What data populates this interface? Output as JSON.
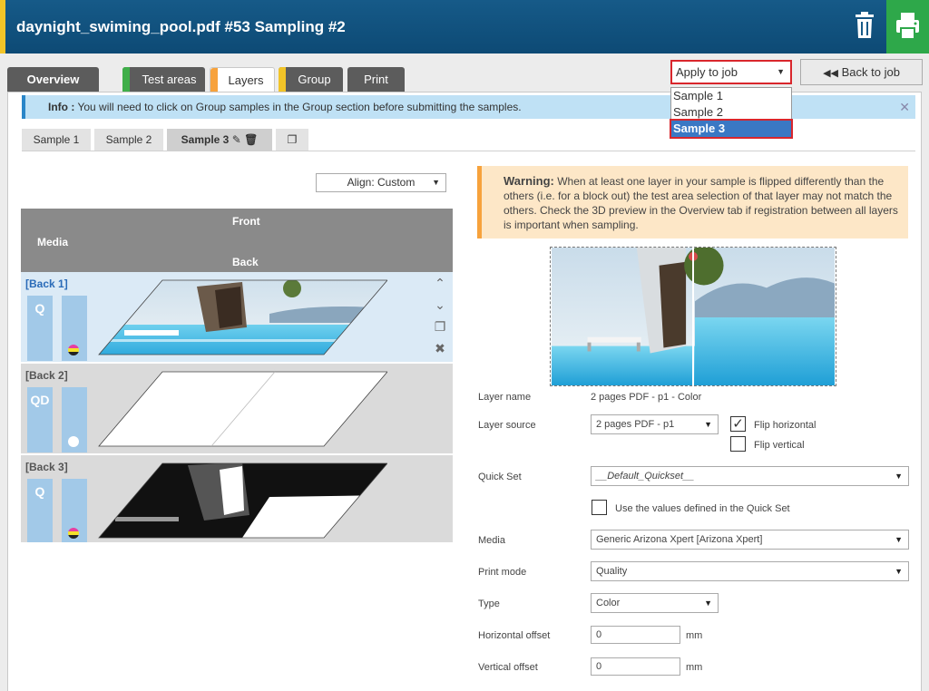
{
  "header": {
    "title": "daynight_swiming_pool.pdf #53 Sampling #2",
    "accent_color": "#f2c428",
    "bg_color": "#0d4a75",
    "print_color": "#2ea84a"
  },
  "tabs": [
    {
      "label": "Overview",
      "indicator": null
    },
    {
      "label": "Test areas",
      "indicator": "#3fae49"
    },
    {
      "label": "Layers",
      "indicator": "#f7a23c"
    },
    {
      "label": "Group",
      "indicator": "#f2c428"
    },
    {
      "label": "Print",
      "indicator": null
    }
  ],
  "apply": {
    "label": "Apply to job",
    "options": [
      "Sample 1",
      "Sample 2",
      "Sample 3"
    ],
    "selected": "Sample 3"
  },
  "back_button": {
    "label": "Back to job"
  },
  "info": {
    "prefix": "Info :",
    "text": "You will need to click on Group samples in the Group section before submitting the samples."
  },
  "sample_tabs": [
    "Sample 1",
    "Sample 2",
    "Sample 3"
  ],
  "align": {
    "label": "Align: Custom"
  },
  "layer_header": {
    "front": "Front",
    "media": "Media",
    "back": "Back"
  },
  "layers": [
    {
      "name": "[Back 1]",
      "mode": "Q",
      "swatch": "cmyk",
      "selected": true
    },
    {
      "name": "[Back 2]",
      "mode": "QD",
      "swatch": "white",
      "selected": false
    },
    {
      "name": "[Back 3]",
      "mode": "Q",
      "swatch": "cmyk",
      "selected": false
    }
  ],
  "warning": {
    "title": "Warning:",
    "text": "When at least one layer in your sample is flipped differently than the others (i.e. for a block out) the test area selection of that layer may not match the others. Check the 3D preview in the Overview tab if registration between all layers is important when sampling."
  },
  "form": {
    "layer_name_label": "Layer name",
    "layer_name_value": "2 pages PDF - p1 - Color",
    "layer_source_label": "Layer source",
    "layer_source_value": "2 pages PDF - p1",
    "flip_horizontal_label": "Flip horizontal",
    "flip_horizontal_checked": true,
    "flip_vertical_label": "Flip vertical",
    "flip_vertical_checked": false,
    "quick_set_label": "Quick Set",
    "quick_set_value": "__Default_Quickset__",
    "use_values_label": "Use the values defined in the Quick Set",
    "media_label": "Media",
    "media_value": "Generic Arizona Xpert [Arizona Xpert]",
    "print_mode_label": "Print mode",
    "print_mode_value": "Quality",
    "type_label": "Type",
    "type_value": "Color",
    "h_offset_label": "Horizontal offset",
    "h_offset_value": "0",
    "h_offset_unit": "mm",
    "v_offset_label": "Vertical offset",
    "v_offset_value": "0",
    "v_offset_unit": "mm"
  }
}
